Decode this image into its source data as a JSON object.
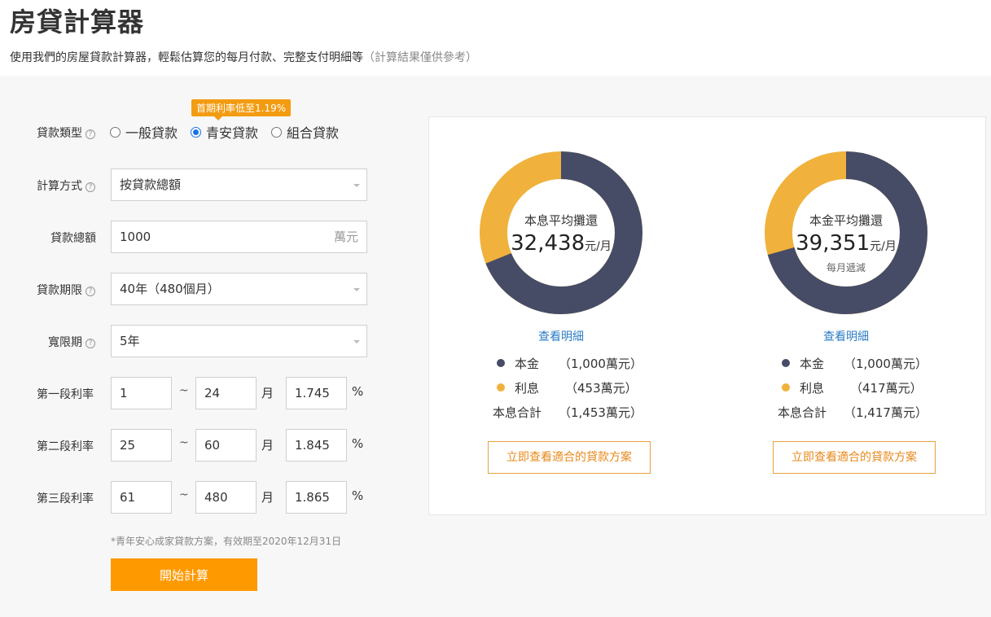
{
  "header": {
    "title": "房貸計算器",
    "subtitle": "使用我們的房屋貸款計算器，輕鬆估算您的每月付款、完整支付明細等",
    "subtitle_note": "（計算結果僅供參考）"
  },
  "form": {
    "loan_type": {
      "label": "貸款類型",
      "promo_badge": "首期利率低至1.19%",
      "options": [
        "一般貸款",
        "青安貸款",
        "組合貸款"
      ],
      "selected": "青安貸款"
    },
    "calc_method": {
      "label": "計算方式",
      "value": "按貸款總額"
    },
    "loan_amount": {
      "label": "貸款總額",
      "value": "1000",
      "unit": "萬元"
    },
    "loan_term": {
      "label": "貸款期限",
      "value": "40年（480個月）"
    },
    "grace_period": {
      "label": "寬限期",
      "value": "5年"
    },
    "rate_tiers": [
      {
        "label": "第一段利率",
        "from": "1",
        "to": "24",
        "rate": "1.745"
      },
      {
        "label": "第二段利率",
        "from": "25",
        "to": "60",
        "rate": "1.845"
      },
      {
        "label": "第三段利率",
        "from": "61",
        "to": "480",
        "rate": "1.865"
      }
    ],
    "tilde": "~",
    "month_unit": "月",
    "percent_unit": "%",
    "footnote": "*青年安心成家貸款方案，有效期至2020年12月31日",
    "submit_label": "開始計算"
  },
  "results": [
    {
      "method": "本息平均攤還",
      "amount": "32,438",
      "per": "元/月",
      "note": "",
      "detail_link": "查看明細",
      "principal_label": "本金",
      "principal_value": "（1,000萬元）",
      "interest_label": "利息",
      "interest_value": "（453萬元）",
      "total_label": "本息合計",
      "total_value": "（1,453萬元）",
      "cta": "立即查看適合的貸款方案",
      "principal_share": 0.688
    },
    {
      "method": "本金平均攤還",
      "amount": "39,351",
      "per": "元/月",
      "note": "每月遞減",
      "detail_link": "查看明細",
      "principal_label": "本金",
      "principal_value": "（1,000萬元）",
      "interest_label": "利息",
      "interest_value": "（417萬元）",
      "total_label": "本息合計",
      "total_value": "（1,417萬元）",
      "cta": "立即查看適合的貸款方案",
      "principal_share": 0.706
    }
  ],
  "colors": {
    "principal": "#464c66",
    "interest": "#f0b23c",
    "accent": "#ff9900",
    "link": "#2b7cc4"
  },
  "icons": {
    "help": "question-circle-icon",
    "dropdown": "caret-down-icon",
    "legend": "dot-icon"
  }
}
